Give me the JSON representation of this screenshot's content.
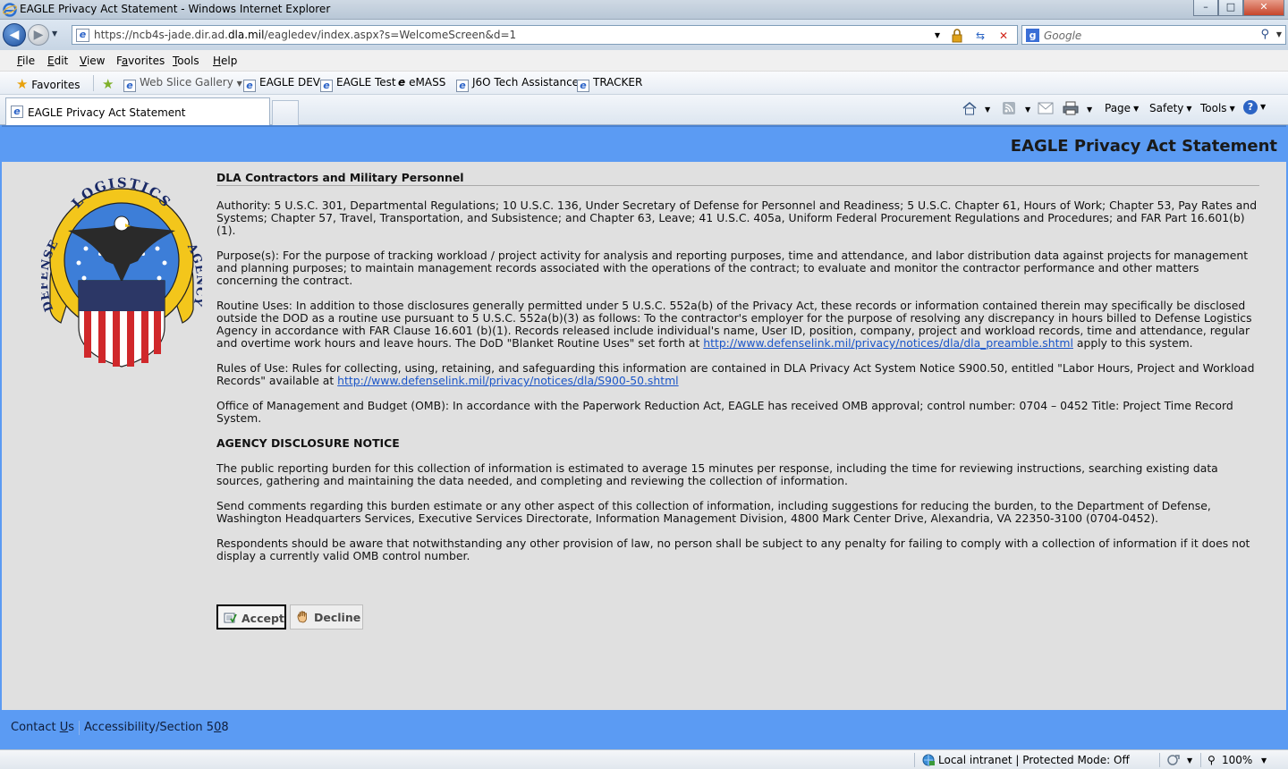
{
  "window": {
    "title": "EAGLE Privacy Act Statement - Windows Internet Explorer",
    "minimize": "–",
    "maximize": "□",
    "close": "✕"
  },
  "address_bar": {
    "url_prefix": "https://ncb4s-jade.dir.ad.",
    "url_domain": "dla.mil",
    "url_suffix": "/eagledev/index.aspx?s=WelcomeScreen&d=1",
    "search_placeholder": "Google"
  },
  "menu": [
    {
      "label_pre": "",
      "hotkey": "F",
      "label_post": "ile"
    },
    {
      "label_pre": "",
      "hotkey": "E",
      "label_post": "dit"
    },
    {
      "label_pre": "",
      "hotkey": "V",
      "label_post": "iew"
    },
    {
      "label_pre": "F",
      "hotkey": "a",
      "label_post": "vorites"
    },
    {
      "label_pre": "",
      "hotkey": "T",
      "label_post": "ools"
    },
    {
      "label_pre": "",
      "hotkey": "H",
      "label_post": "elp"
    }
  ],
  "favorites_bar": {
    "favorites_label": "Favorites",
    "links": [
      "Web Slice Gallery",
      "EAGLE DEV",
      "EAGLE Test",
      "eMASS",
      "J6O Tech Assistance",
      "TRACKER"
    ]
  },
  "tabs": {
    "active_label": "EAGLE Privacy Act Statement"
  },
  "command_bar": {
    "page": "Page",
    "safety": "Safety",
    "tools": "Tools"
  },
  "page": {
    "header_title": "EAGLE Privacy Act Statement",
    "seal": {
      "top_text": "LOGISTICS",
      "left_text": "DEFENSE",
      "right_text": "AGENCY"
    },
    "section_title": "DLA Contractors and Military Personnel",
    "authority": "Authority: 5 U.S.C. 301, Departmental Regulations; 10 U.S.C. 136, Under Secretary of Defense for Personnel and Readiness; 5 U.S.C. Chapter 61, Hours of Work; Chapter 53, Pay Rates and Systems; Chapter 57, Travel, Transportation, and Subsistence; and Chapter 63, Leave; 41 U.S.C. 405a, Uniform Federal Procurement Regulations and Procedures; and FAR Part 16.601(b)(1).",
    "purpose": "Purpose(s): For the purpose of tracking workload / project activity for analysis and reporting purposes, time and attendance, and labor distribution data against projects for management and planning purposes; to maintain management records associated with the operations of the contract; to evaluate and monitor the contractor performance and other matters concerning the contract.",
    "routine_uses_pre": "Routine Uses: In addition to those disclosures generally permitted under 5 U.S.C. 552a(b) of the Privacy Act, these records or information contained therein may specifically be disclosed outside the DOD as a routine use pursuant to 5 U.S.C. 552a(b)(3) as follows: To the contractor's employer for the purpose of resolving any discrepancy in hours billed to Defense Logistics Agency in accordance with FAR Clause 16.601 (b)(1). Records released include individual's name, User ID, position, company, project and workload records, time and attendance, regular and overtime work hours and leave hours. The DoD \"Blanket Routine Uses\" set forth at ",
    "routine_uses_link": "http://www.defenselink.mil/privacy/notices/dla/dla_preamble.shtml",
    "routine_uses_post": " apply to this system.",
    "rules_pre": "Rules of Use: Rules for collecting, using, retaining, and safeguarding this information are contained in DLA Privacy Act System Notice S900.50, entitled \"Labor Hours, Project and Workload Records\" available at ",
    "rules_link": "http://www.defenselink.mil/privacy/notices/dla/S900-50.shtml",
    "omb": "Office of Management and Budget (OMB): In accordance with the Paperwork Reduction Act, EAGLE has received OMB approval; control number: 0704 – 0452 Title: Project Time Record System.",
    "disclosure_title": "AGENCY DISCLOSURE NOTICE",
    "burden": "The public reporting burden for this collection of information is estimated to average 15 minutes per response, including the time for reviewing instructions, searching existing data sources, gathering and maintaining the data needed, and completing and reviewing the collection of information.",
    "comments": "Send comments regarding this burden estimate or any other aspect of this collection of information, including suggestions for reducing the burden, to the Department of Defense, Washington Headquarters Services, Executive Services Directorate, Information Management Division, 4800 Mark Center Drive, Alexandria, VA 22350-3100 (0704-0452).",
    "respondents": "Respondents should be aware that notwithstanding any other provision of law, no person shall be subject to any penalty for failing to comply with a collection of information if it does not display a currently valid OMB control number.",
    "accept_label": "Accept",
    "decline_label": "Decline",
    "footer_contact_pre": "Contact ",
    "footer_contact_hotkey": "U",
    "footer_contact_post": "s",
    "footer_access_pre": "Accessibility/Section 5",
    "footer_access_hotkey": "0",
    "footer_access_post": "8"
  },
  "status_bar": {
    "zone": "Local intranet | Protected Mode: Off",
    "zoom": "100%"
  },
  "colors": {
    "header_blue": "#5b9bf3",
    "page_bg": "#e0e0e0",
    "link": "#1a55c8"
  }
}
